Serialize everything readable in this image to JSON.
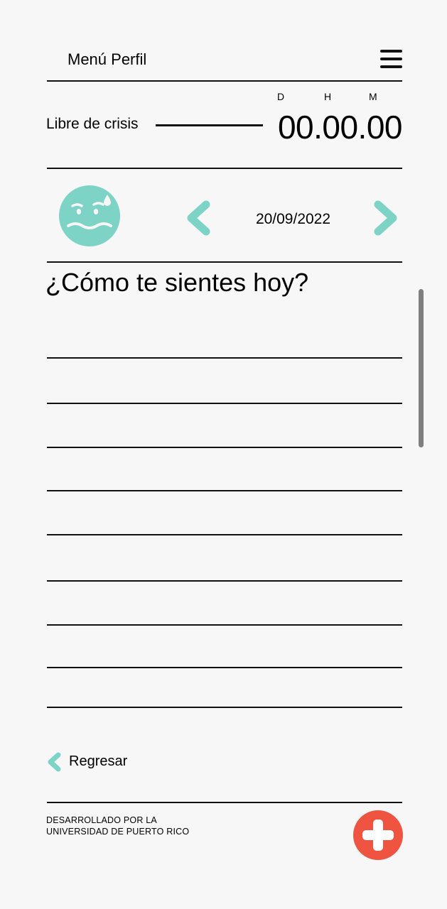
{
  "header": {
    "title": "Menú Perfil"
  },
  "timer": {
    "label": "Libre de crisis",
    "units": {
      "days": "D",
      "hours": "H",
      "minutes": "M"
    },
    "value": "00.00.00"
  },
  "mood": {
    "face_icon": "worried-sweat-face-icon",
    "date": "20/09/2022"
  },
  "journal": {
    "question": "¿Cómo te sientes hoy?",
    "line_count": 9
  },
  "footer": {
    "back_label": "Regresar",
    "credit_line1": "DESARROLLADO POR LA",
    "credit_line2": "UNIVERSIDAD DE PUERTO RICO"
  },
  "colors": {
    "accent": "#7dd3c6",
    "emergency": "#ee5440",
    "background": "#f7f7f7",
    "text": "#000000"
  }
}
